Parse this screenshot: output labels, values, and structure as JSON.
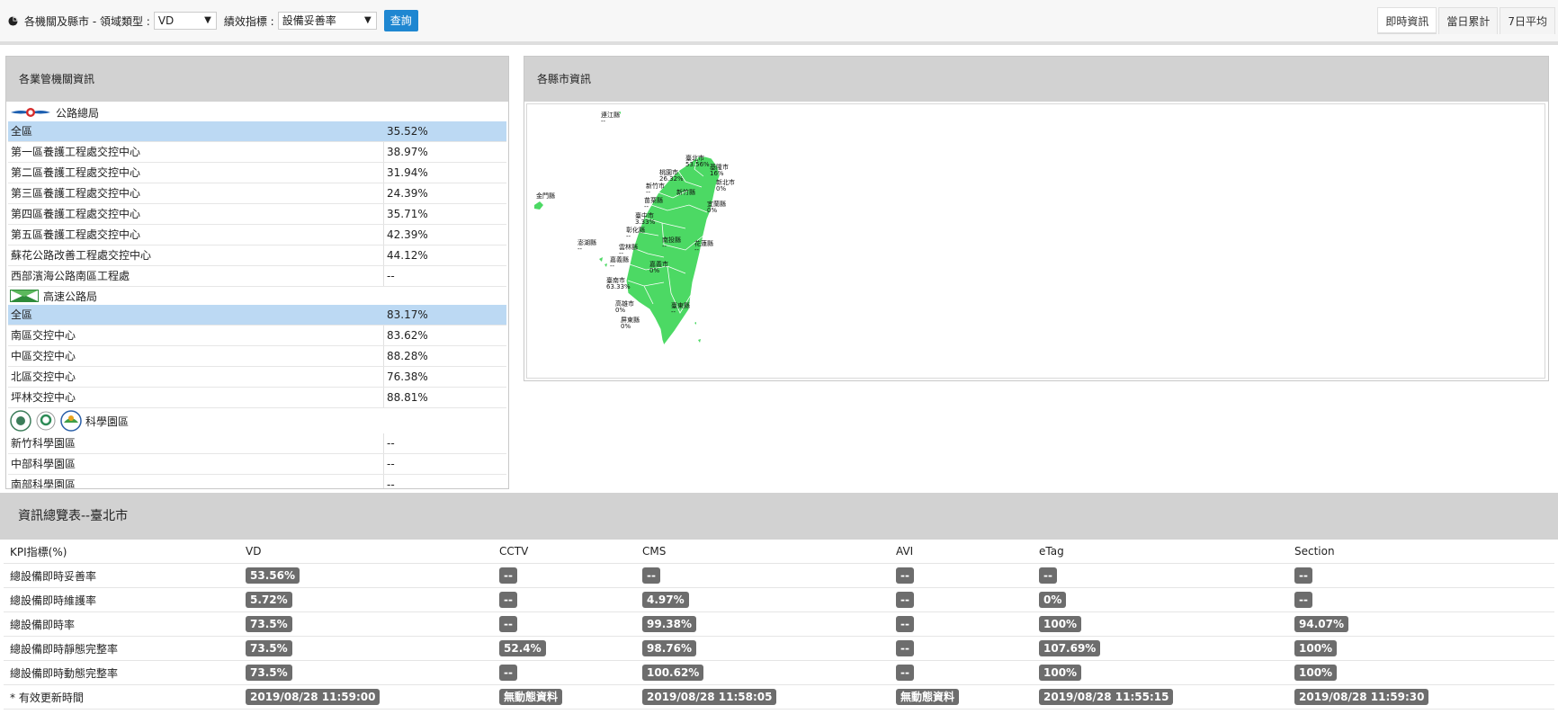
{
  "toolbar": {
    "prefix": "各機關及縣市 - 領域類型 :",
    "type_value": "VD",
    "kpi_label": "績效指標 :",
    "kpi_value": "設備妥善率",
    "query_label": "查詢"
  },
  "tabs": [
    {
      "label": "即時資訊"
    },
    {
      "label": "當日累計"
    },
    {
      "label": "7日平均"
    }
  ],
  "left_panel": {
    "title": "各業管機關資訊",
    "groups": [
      {
        "name": "公路總局",
        "logo": "highway-bureau-logo",
        "rows": [
          {
            "name": "全區",
            "value": "35.52%"
          },
          {
            "name": "第一區養護工程處交控中心",
            "value": "38.97%"
          },
          {
            "name": "第二區養護工程處交控中心",
            "value": "31.94%"
          },
          {
            "name": "第三區養護工程處交控中心",
            "value": "24.39%"
          },
          {
            "name": "第四區養護工程處交控中心",
            "value": "35.71%"
          },
          {
            "name": "第五區養護工程處交控中心",
            "value": "42.39%"
          },
          {
            "name": "蘇花公路改善工程處交控中心",
            "value": "44.12%"
          },
          {
            "name": "西部濱海公路南區工程處",
            "value": "--"
          }
        ]
      },
      {
        "name": "高速公路局",
        "logo": "freeway-bureau-logo",
        "rows": [
          {
            "name": "全區",
            "value": "83.17%"
          },
          {
            "name": "南區交控中心",
            "value": "83.62%"
          },
          {
            "name": "中區交控中心",
            "value": "88.28%"
          },
          {
            "name": "北區交控中心",
            "value": "76.38%"
          },
          {
            "name": "坪林交控中心",
            "value": "88.81%"
          }
        ]
      },
      {
        "name": "科學園區",
        "logo": "science-park-logos",
        "rows": [
          {
            "name": "新竹科學園區",
            "value": "--"
          },
          {
            "name": "中部科學園區",
            "value": "--"
          },
          {
            "name": "南部科學園區",
            "value": "--"
          }
        ]
      }
    ]
  },
  "map_panel": {
    "title": "各縣市資訊",
    "labels": [
      {
        "name": "連江縣",
        "value": "--"
      },
      {
        "name": "臺北市",
        "value": "53.56%"
      },
      {
        "name": "基隆市",
        "value": "16%"
      },
      {
        "name": "桃園市",
        "value": "26.32%"
      },
      {
        "name": "新北市",
        "value": "0%"
      },
      {
        "name": "新竹市",
        "value": "--"
      },
      {
        "name": "新竹縣",
        "value": ""
      },
      {
        "name": "苗栗縣",
        "value": "--"
      },
      {
        "name": "宜蘭縣",
        "value": "0%"
      },
      {
        "name": "金門縣",
        "value": ""
      },
      {
        "name": "臺中市",
        "value": "3.33%"
      },
      {
        "name": "彰化縣",
        "value": "--"
      },
      {
        "name": "南投縣",
        "value": "--"
      },
      {
        "name": "澎湖縣",
        "value": "--"
      },
      {
        "name": "雲林縣",
        "value": "--"
      },
      {
        "name": "花蓮縣",
        "value": "--"
      },
      {
        "name": "嘉義縣",
        "value": "--"
      },
      {
        "name": "嘉義市",
        "value": "0%"
      },
      {
        "name": "臺南市",
        "value": "63.33%"
      },
      {
        "name": "高雄市",
        "value": "0%"
      },
      {
        "name": "臺東縣",
        "value": "--"
      },
      {
        "name": "屏東縣",
        "value": "0%"
      }
    ]
  },
  "summary": {
    "title": "資訊總覽表--臺北市",
    "columns": [
      "KPI指標(%)",
      "VD",
      "CCTV",
      "CMS",
      "AVI",
      "eTag",
      "Section"
    ],
    "rows": [
      {
        "label": "總設備即時妥善率",
        "cells": [
          "53.56%",
          "--",
          "--",
          "--",
          "--",
          "--"
        ]
      },
      {
        "label": "總設備即時維護率",
        "cells": [
          "5.72%",
          "--",
          "4.97%",
          "--",
          "0%",
          "--"
        ]
      },
      {
        "label": "總設備即時率",
        "cells": [
          "73.5%",
          "--",
          "99.38%",
          "--",
          "100%",
          "94.07%"
        ]
      },
      {
        "label": "總設備即時靜態完整率",
        "cells": [
          "73.5%",
          "52.4%",
          "98.76%",
          "--",
          "107.69%",
          "100%"
        ]
      },
      {
        "label": "總設備即時動態完整率",
        "cells": [
          "73.5%",
          "--",
          "100.62%",
          "--",
          "100%",
          "100%"
        ]
      },
      {
        "label": "* 有效更新時間",
        "cells": [
          "2019/08/28 11:59:00",
          "無動態資料",
          "2019/08/28 11:58:05",
          "無動態資料",
          "2019/08/28 11:55:15",
          "2019/08/28 11:59:30"
        ]
      }
    ]
  }
}
